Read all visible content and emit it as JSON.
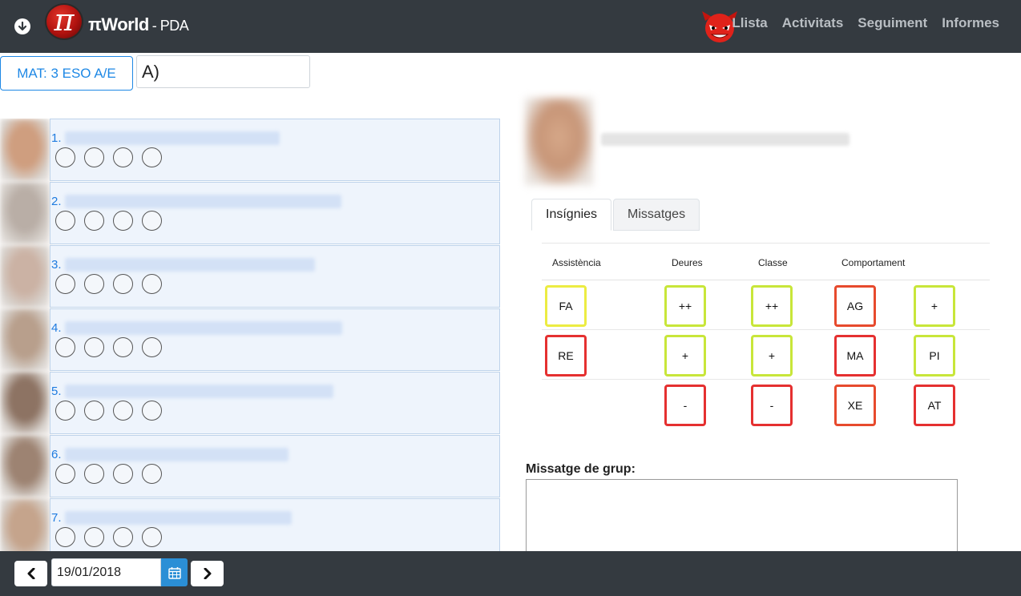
{
  "header": {
    "logo_text": "π",
    "brand": "πWorld",
    "brand_sub": "- PDA",
    "nav": [
      "Llista",
      "Activitats",
      "Seguiment",
      "Informes"
    ]
  },
  "group_selector": {
    "label": "MAT: 3 ESO A/E"
  },
  "filter": {
    "value": "A)"
  },
  "students": [
    {
      "number": "1.",
      "color": "#cf9e7f"
    },
    {
      "number": "2.",
      "color": "#b9aea6"
    },
    {
      "number": "3.",
      "color": "#cbb2a4"
    },
    {
      "number": "4.",
      "color": "#b89f8c"
    },
    {
      "number": "5.",
      "color": "#8d7363"
    },
    {
      "number": "6.",
      "color": "#9d8372"
    },
    {
      "number": "7.",
      "color": "#c5a48c"
    }
  ],
  "tabs": [
    {
      "label": "Insígnies",
      "active": true
    },
    {
      "label": "Missatges",
      "active": false
    }
  ],
  "badges": {
    "headers": {
      "assistencia": "Assistència",
      "deures": "Deures",
      "classe": "Classe",
      "comportament": "Comportament"
    },
    "rows": [
      {
        "assistencia": "FA",
        "deures": "++",
        "classe": "++",
        "comportament_1": "AG",
        "comportament_2": "+"
      },
      {
        "assistencia": "RE",
        "deures": "+",
        "classe": "+",
        "comportament_1": "MA",
        "comportament_2": "PI"
      },
      {
        "assistencia": "",
        "deures": "-",
        "classe": "-",
        "comportament_1": "XE",
        "comportament_2": "AT"
      }
    ]
  },
  "group_message": {
    "label": "Missatge de grup:",
    "value": ""
  },
  "footer": {
    "date": "19/01/2018"
  }
}
